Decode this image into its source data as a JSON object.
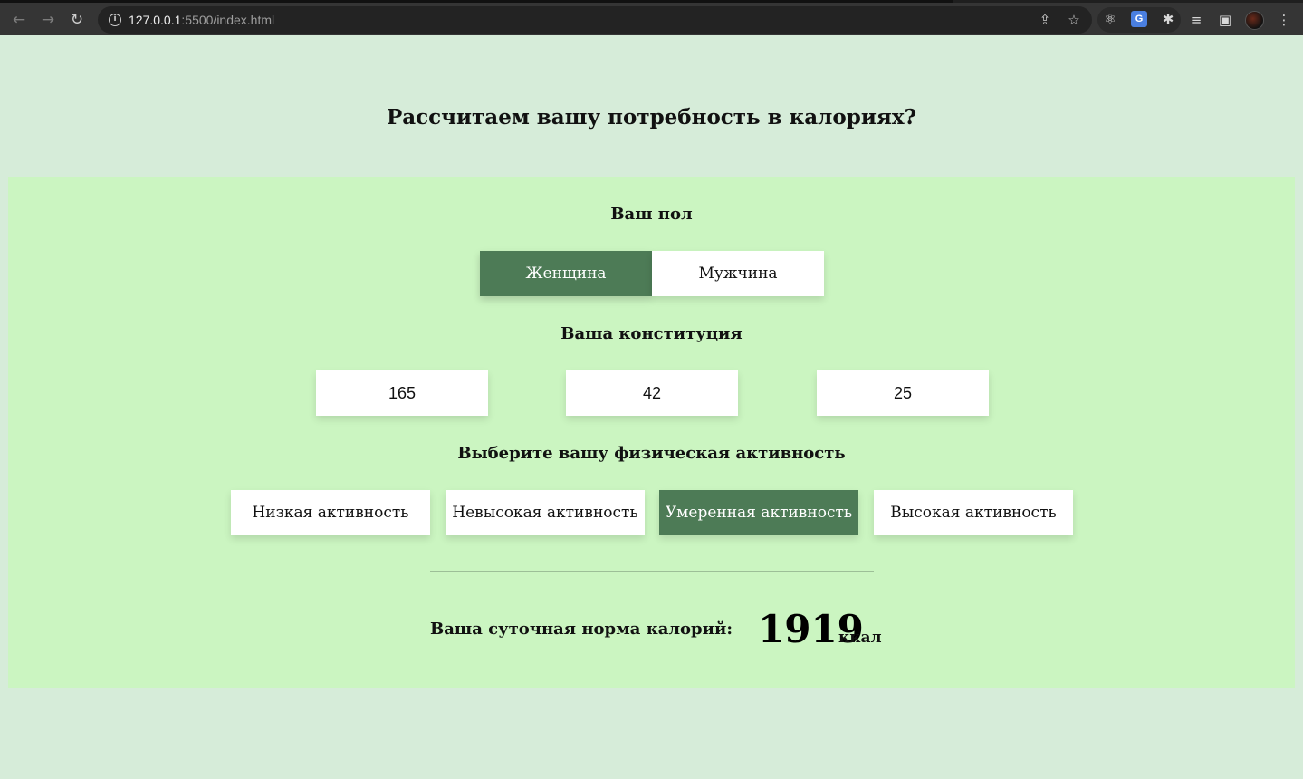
{
  "browser": {
    "url_host": "127.0.0.1",
    "url_rest": ":5500/index.html",
    "icons": [
      "back-icon",
      "forward-icon",
      "reload-icon",
      "info-icon",
      "share-icon",
      "star-icon",
      "react-devtools-icon",
      "google-translate-icon",
      "extensions-icon",
      "reading-list-icon",
      "side-panel-icon",
      "profile-avatar",
      "menu-icon"
    ]
  },
  "page": {
    "title": "Рассчитаем вашу потребность в калориях?"
  },
  "gender": {
    "title": "Ваш пол",
    "options": [
      {
        "label": "Женщина",
        "active": true
      },
      {
        "label": "Мужчина",
        "active": false
      }
    ]
  },
  "constitution": {
    "title": "Ваша конституция",
    "height": "165",
    "weight": "42",
    "age": "25"
  },
  "activity": {
    "title": "Выберите вашу физическая активность",
    "options": [
      {
        "label": "Низкая активность",
        "active": false
      },
      {
        "label": "Невысокая активность",
        "active": false
      },
      {
        "label": "Умеренная активность",
        "active": true
      },
      {
        "label": "Высокая активность",
        "active": false
      }
    ]
  },
  "result": {
    "label": "Ваша суточная норма калорий:",
    "value": "1919",
    "unit": "ккал"
  },
  "colors": {
    "page_bg": "#d6ecd9",
    "panel_bg": "#cbf5c1",
    "active_bg": "#4d7b56"
  }
}
